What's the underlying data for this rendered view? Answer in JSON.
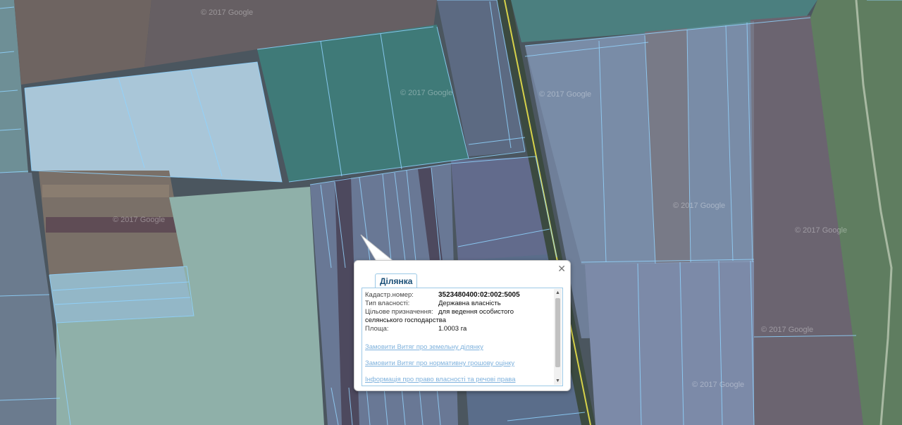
{
  "map": {
    "watermarks": [
      "© 2017 Google",
      "© 2017 Google",
      "© 2017 Google",
      "© 2017 Google",
      "© 2017 Google",
      "© 2017 Google",
      "© 2017 Google",
      "© 2017 Google"
    ]
  },
  "popup": {
    "tab_label": "Ділянка",
    "close_icon": "close-icon",
    "fields": {
      "cadastral_label": "Кадастр.номер:",
      "cadastral_value": "3523480400:02:002:5005",
      "ownership_label": "Тип власності:",
      "ownership_value": "Державна власність",
      "purpose_label": "Цільове призначення:",
      "purpose_value": "для ведення особистого",
      "purpose_value_cont": "селянського господарства",
      "area_label": "Площа:",
      "area_value": "1.0003 га"
    },
    "links": [
      "Замовити Витяг про земельну ділянку",
      "Замовити Витяг про нормативну грошову оцінку",
      "Інформація про право власності та речові права"
    ]
  },
  "colors": {
    "parcel_outline": "#8fd3ff",
    "road": "#d7d24a",
    "link": "#7fb2dd",
    "tab_border": "#9cc9e6"
  }
}
